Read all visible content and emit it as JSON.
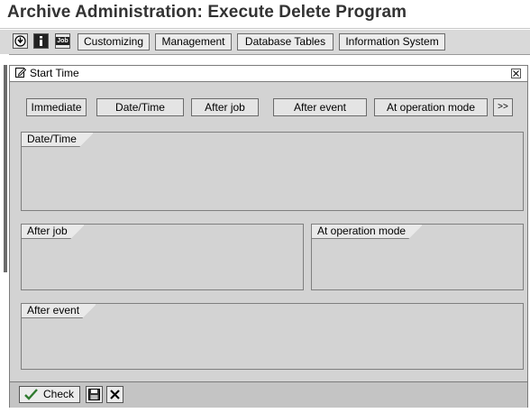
{
  "window": {
    "title": "Archive Administration: Execute Delete Program"
  },
  "toolbar": {
    "icons": [
      {
        "name": "execute-icon"
      },
      {
        "name": "info-icon"
      },
      {
        "name": "job-icon",
        "text": "Job"
      }
    ],
    "buttons": [
      "Customizing",
      "Management",
      "Database Tables",
      "Information System"
    ]
  },
  "dialog": {
    "title": "Start Time",
    "options": [
      "Immediate",
      "Date/Time",
      "After job",
      "After event",
      "At operation mode",
      ">>"
    ],
    "groups": {
      "date_time": "Date/Time",
      "after_job": "After job",
      "at_operation_mode": "At operation mode",
      "after_event": "After event"
    },
    "footer": {
      "check_label": "Check"
    }
  },
  "colors": {
    "dialog_bg": "#d3d3d3",
    "toolbar_bg": "#d9d9d9",
    "check_icon": "#2f7a2f"
  }
}
